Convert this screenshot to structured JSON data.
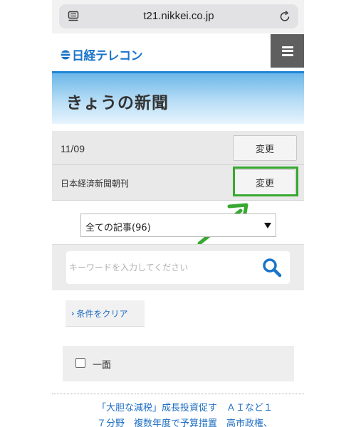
{
  "browser": {
    "url": "t21.nikkei.co.jp"
  },
  "header": {
    "logo_text": "日経テレコン"
  },
  "page": {
    "title": "きょうの新聞"
  },
  "filters": {
    "date": "11/09",
    "date_change_label": "変更",
    "paper": "日本経済新聞朝刊",
    "paper_change_label": "変更",
    "category_selected": "全ての記事(96)"
  },
  "search": {
    "placeholder": "キーワードを入力してください"
  },
  "clear_label": "条件をクリア",
  "section": {
    "label": "一面"
  },
  "article": {
    "line1": "「大胆な減税」成長投資促す　ＡＩなど１",
    "line2": "７分野　複数年度で予算措置　高市政権、"
  },
  "colors": {
    "accent_blue": "#1f85d6",
    "link_blue": "#1f6fc2",
    "annotation_green": "#37a830"
  }
}
